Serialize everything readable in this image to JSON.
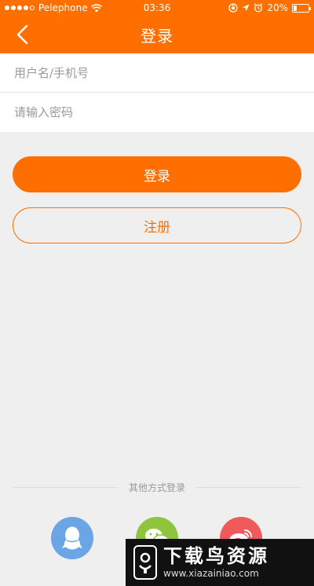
{
  "status_bar": {
    "carrier": "Pelephone",
    "time": "03:36",
    "battery": "20%",
    "battery_level": 0.2
  },
  "nav": {
    "title": "登录"
  },
  "form": {
    "username_placeholder": "用户名/手机号",
    "password_placeholder": "请输入密码"
  },
  "buttons": {
    "login_label": "登录",
    "register_label": "注册"
  },
  "other_login": {
    "label": "其他方式登录",
    "providers": [
      "qq-icon",
      "wechat-icon",
      "weibo-icon"
    ]
  },
  "watermark": {
    "title": "下载鸟资源",
    "url": "www.xiazainiao.com"
  },
  "colors": {
    "accent": "#ff6f00",
    "background": "#efefef",
    "qq": "#6aa6e6",
    "wechat": "#8fc43e",
    "weibo": "#ef5a5a"
  }
}
